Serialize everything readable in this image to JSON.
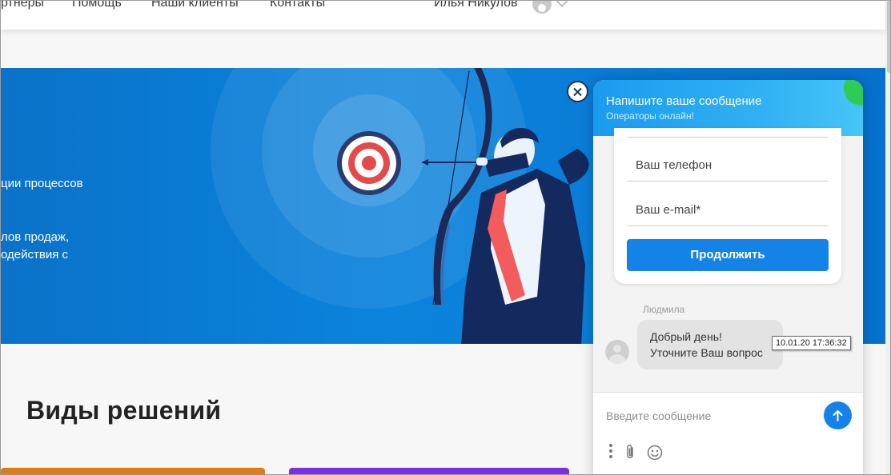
{
  "header": {
    "nav": [
      "ртнеры",
      "Помощь",
      "Наши клиенты",
      "Контакты"
    ],
    "user_name": "Илья Никулов"
  },
  "hero": {
    "lines": [
      "ции процессов",
      "лов продаж,",
      "одействия с"
    ]
  },
  "solutions": {
    "title": "Виды решений"
  },
  "chat": {
    "title": "Напишите ваше сообщение",
    "subtitle": "Операторы онлайн!",
    "fields": {
      "phone": "Ваш телефон",
      "email": "Ваш e-mail*"
    },
    "continue_label": "Продолжить",
    "message": {
      "sender": "Людмила",
      "line1": "Добрый день!",
      "line2": "Уточните Ваш вопрос",
      "time": "10.01.20 17:36:32"
    },
    "compose_placeholder": "Введите сообщение",
    "icons": {
      "send": "arrow-up-icon",
      "menu": "more-vertical-icon",
      "attach": "paperclip-icon",
      "emoji": "smiley-icon",
      "close": "close-icon"
    }
  },
  "colors": {
    "hero_blue": "#0b84dd",
    "button_blue": "#1383e8",
    "online_green": "#2fcc55",
    "accent_orange": "#e07a12",
    "accent_purple": "#7b2fe0"
  }
}
